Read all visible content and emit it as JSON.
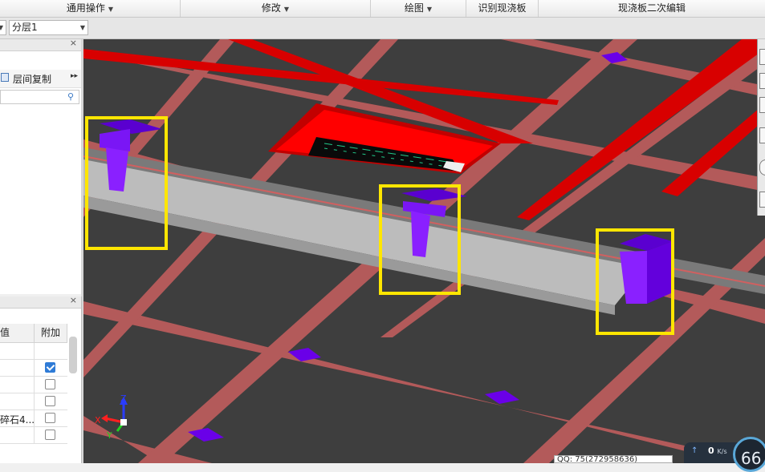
{
  "menubar": {
    "items": [
      {
        "label": "通用操作",
        "has_dropdown": true
      },
      {
        "label": "修改",
        "has_dropdown": true
      },
      {
        "label": "绘图",
        "has_dropdown": true
      },
      {
        "label": "识别现浇板",
        "has_dropdown": false
      },
      {
        "label": "现浇板二次编辑",
        "has_dropdown": false
      }
    ]
  },
  "toolbar2": {
    "floor_select": {
      "value": "分层1"
    }
  },
  "panel_top": {
    "copy_label": "层间复制",
    "search": {
      "placeholder": ""
    }
  },
  "property_grid": {
    "headers": {
      "value": "值",
      "extra": "附加"
    },
    "rows": [
      {
        "value": "",
        "checked": null
      },
      {
        "value": "",
        "checked": true
      },
      {
        "value": "",
        "checked": false
      },
      {
        "value": "",
        "checked": false
      },
      {
        "value": "碎石4...",
        "checked": false
      },
      {
        "value": "",
        "checked": false
      }
    ]
  },
  "viewport": {
    "axis_labels": {
      "x": "X",
      "y": "Y",
      "z": "Z"
    },
    "colors": {
      "background": "#3e3e3e",
      "beam_strip": "#b35a5a",
      "red_beam": "#d80000",
      "slab_edge": "#8a8a8a",
      "column_purple": "#6a00e8",
      "highlight_box": "#ffe600"
    }
  },
  "status": {
    "qq_text": "QQ: 75(272958636)",
    "net_speed": "0",
    "net_unit": "K/s",
    "gauge_value": "66"
  },
  "icons": [
    "dropdown-caret-icon",
    "close-icon",
    "copy-icon",
    "search-icon",
    "checkbox-icon",
    "axis-triad-icon",
    "upload-arrow-icon"
  ]
}
